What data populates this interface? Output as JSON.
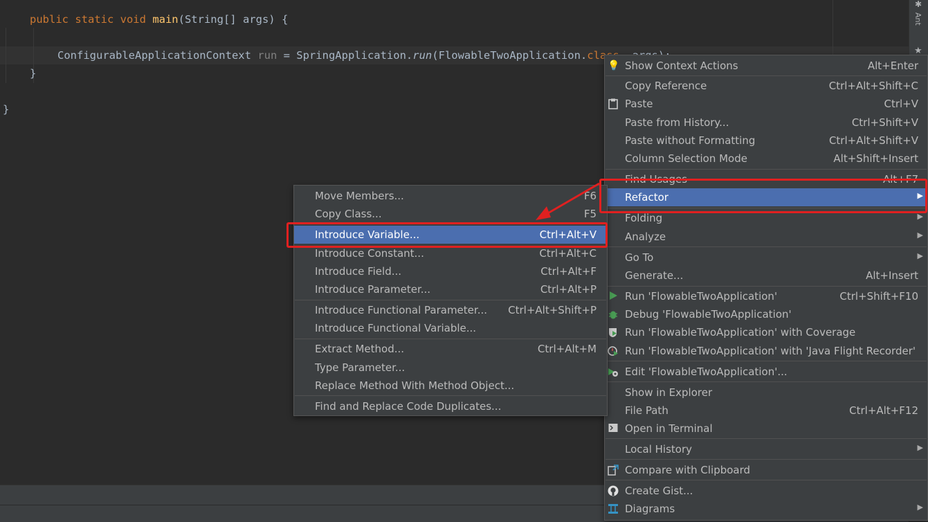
{
  "code": {
    "line1": {
      "kw": "public static void ",
      "fn": "main",
      "rest": "(String[] args) {"
    },
    "line2": {
      "type": "ConfigurableApplicationContext ",
      "var": "run",
      "assign": " = SpringApplication.",
      "call": "run",
      "args": "(FlowableTwoApplication.",
      "kw_class": "class",
      "args_end": ", args);"
    },
    "line3": "}",
    "line4": "}"
  },
  "side_tool": {
    "label": "Ant",
    "icon": "ant-icon",
    "favorites_icon": "star-icon"
  },
  "context_menu": {
    "items": [
      {
        "label": "Show Context Actions",
        "shortcut": "Alt+Enter",
        "icon": "bulb-icon"
      },
      {
        "label": "Copy Reference",
        "shortcut": "Ctrl+Alt+Shift+C"
      },
      {
        "label": "Paste",
        "shortcut": "Ctrl+V",
        "icon": "clipboard-icon"
      },
      {
        "label": "Paste from History...",
        "shortcut": "Ctrl+Shift+V"
      },
      {
        "label": "Paste without Formatting",
        "shortcut": "Ctrl+Alt+Shift+V"
      },
      {
        "label": "Column Selection Mode",
        "shortcut": "Alt+Shift+Insert"
      },
      {
        "label": "Find Usages",
        "shortcut": "Alt+F7"
      },
      {
        "label": "Refactor",
        "shortcut": "",
        "submenu": true
      },
      {
        "label": "Folding",
        "submenu": true
      },
      {
        "label": "Analyze",
        "submenu": true
      },
      {
        "label": "Go To",
        "submenu": true
      },
      {
        "label": "Generate...",
        "shortcut": "Alt+Insert"
      },
      {
        "label": "Run 'FlowableTwoApplication'",
        "shortcut": "Ctrl+Shift+F10",
        "icon": "run-icon"
      },
      {
        "label": "Debug 'FlowableTwoApplication'",
        "icon": "debug-icon"
      },
      {
        "label": "Run 'FlowableTwoApplication' with Coverage",
        "icon": "coverage-icon"
      },
      {
        "label": "Run 'FlowableTwoApplication' with 'Java Flight Recorder'",
        "icon": "profiler-icon"
      },
      {
        "label": "Edit 'FlowableTwoApplication'...",
        "icon": "edit-config-icon"
      },
      {
        "label": "Show in Explorer"
      },
      {
        "label": "File Path",
        "shortcut": "Ctrl+Alt+F12"
      },
      {
        "label": "Open in Terminal",
        "icon": "terminal-icon"
      },
      {
        "label": "Local History",
        "submenu": true
      },
      {
        "label": "Compare with Clipboard",
        "icon": "compare-icon"
      },
      {
        "label": "Create Gist...",
        "icon": "github-icon"
      },
      {
        "label": "Diagrams",
        "submenu": true,
        "icon": "diagram-icon"
      }
    ]
  },
  "refactor_menu": {
    "items": [
      {
        "label": "Move Members...",
        "shortcut": "F6"
      },
      {
        "label": "Copy Class...",
        "shortcut": "F5"
      },
      {
        "label": "Introduce Variable...",
        "shortcut": "Ctrl+Alt+V"
      },
      {
        "label": "Introduce Constant...",
        "shortcut": "Ctrl+Alt+C"
      },
      {
        "label": "Introduce Field...",
        "shortcut": "Ctrl+Alt+F"
      },
      {
        "label": "Introduce Parameter...",
        "shortcut": "Ctrl+Alt+P"
      },
      {
        "label": "Introduce Functional Parameter...",
        "shortcut": "Ctrl+Alt+Shift+P"
      },
      {
        "label": "Introduce Functional Variable..."
      },
      {
        "label": "Extract Method...",
        "shortcut": "Ctrl+Alt+M"
      },
      {
        "label": "Type Parameter..."
      },
      {
        "label": "Replace Method With Method Object..."
      },
      {
        "label": "Find and Replace Code Duplicates..."
      }
    ]
  },
  "colors": {
    "editor_bg": "#2b2b2b",
    "menu_bg": "#3c3f41",
    "selection": "#4b6eaf",
    "annotation_red": "#e02020"
  }
}
